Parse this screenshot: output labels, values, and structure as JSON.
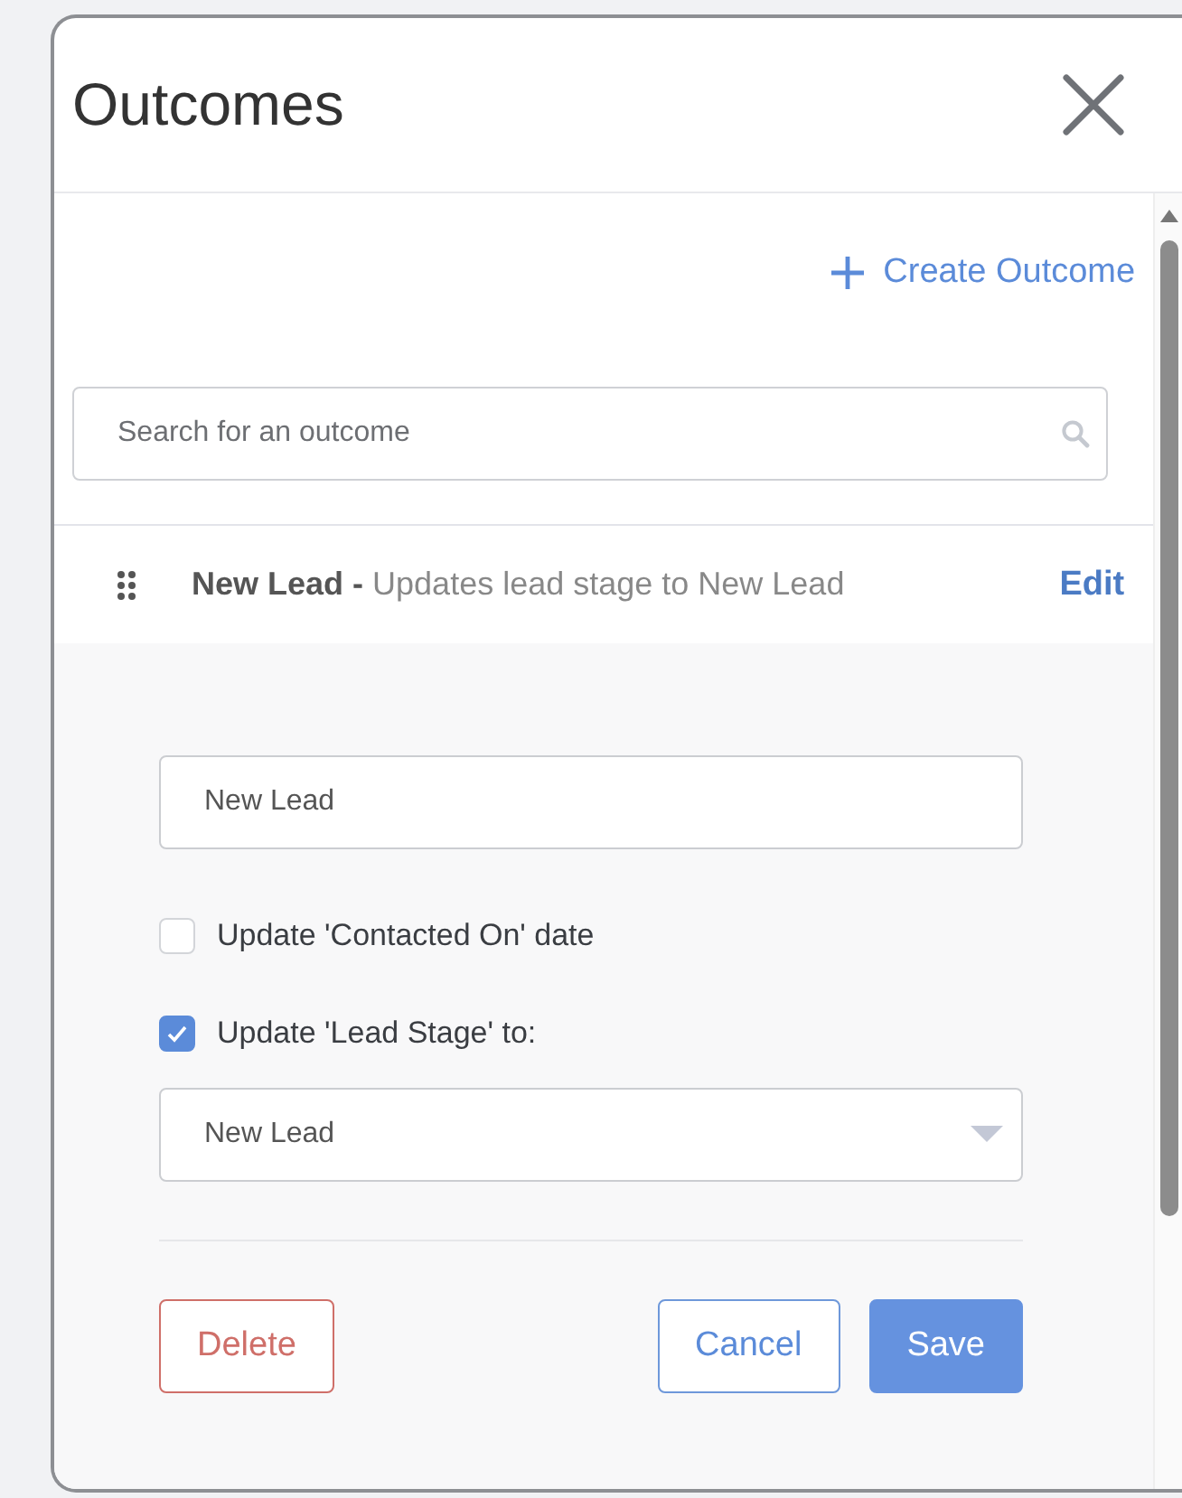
{
  "panel": {
    "title": "Outcomes"
  },
  "create_outcome": {
    "label": "Create Outcome"
  },
  "search": {
    "placeholder": "Search for an outcome"
  },
  "outcome": {
    "summary": "**New Lead -** Updates lead stage to New Lead",
    "edit": "Edit"
  },
  "form": {
    "name_value": "New Lead",
    "options": [
      {
        "label": "Update 'Contacted On' date",
        "checked": false
      },
      {
        "label": "Update 'Lead Stage' to:",
        "checked": true
      }
    ],
    "stage_value": "New Lead"
  },
  "buttons": [
    {
      "label": "Delete",
      "kind": "danger"
    },
    {
      "label": "Cancel",
      "kind": "secondary"
    },
    {
      "label": "Save",
      "kind": "primary"
    }
  ]
}
